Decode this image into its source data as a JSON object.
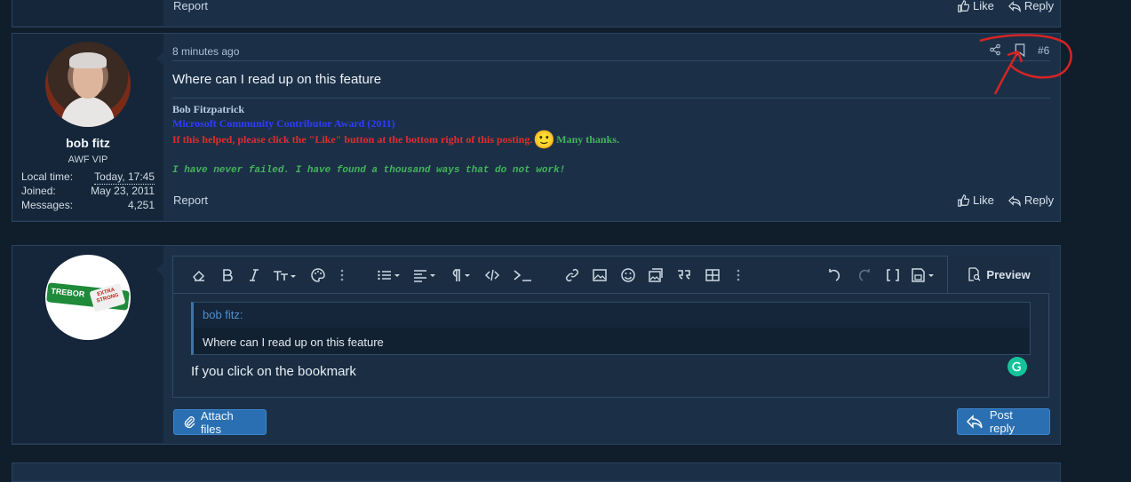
{
  "top_strip": {
    "report": "Report",
    "like": "Like",
    "reply": "Reply"
  },
  "post": {
    "time": "8 minutes ago",
    "number": "#6",
    "message": "Where can I read up on this feature",
    "author": {
      "name": "bob fitz",
      "title": "AWF VIP",
      "stats": [
        {
          "label": "Local time:",
          "value": "Today, 17:45"
        },
        {
          "label": "Joined:",
          "value": "May 23, 2011"
        },
        {
          "label": "Messages:",
          "value": "4,251"
        }
      ]
    },
    "signature": {
      "name": "Bob Fitzpatrick",
      "award": "Microsoft Community Contributor Award (2011)",
      "help_text": "If this helped, please click the \"Like\" button at the bottom right of this posting.",
      "thanks": "Many thanks.",
      "quote": "I have never failed. I have found a thousand ways that do not work!",
      "emoji": "🙂"
    },
    "report": "Report",
    "like": "Like",
    "reply": "Reply",
    "colors": {
      "help": "#e02c2c",
      "award": "#2f3cff",
      "green": "#43b45a"
    }
  },
  "reply_box": {
    "avatar_text": {
      "left": "TREBOR",
      "right": "EXTRA STRONG"
    },
    "preview_label": "Preview",
    "quote_author": "bob fitz:",
    "quote_text": "Where can I read up on this feature",
    "typed_text": "If you click on the bookmark",
    "attach_label": "Attach files",
    "post_reply_label": "Post reply",
    "toolbar_icons": [
      "eraser-icon",
      "bold-icon",
      "italic-icon",
      "text-size-icon",
      "palette-icon",
      "more-vertical-icon",
      "list-icon",
      "align-icon",
      "paragraph-icon",
      "code-icon",
      "terminal-icon",
      "link-icon",
      "image-icon",
      "smiley-icon",
      "media-icon",
      "quote-icon",
      "table-icon",
      "more-vertical-icon",
      "undo-icon",
      "redo-icon",
      "brackets-icon",
      "save-draft-icon"
    ]
  }
}
